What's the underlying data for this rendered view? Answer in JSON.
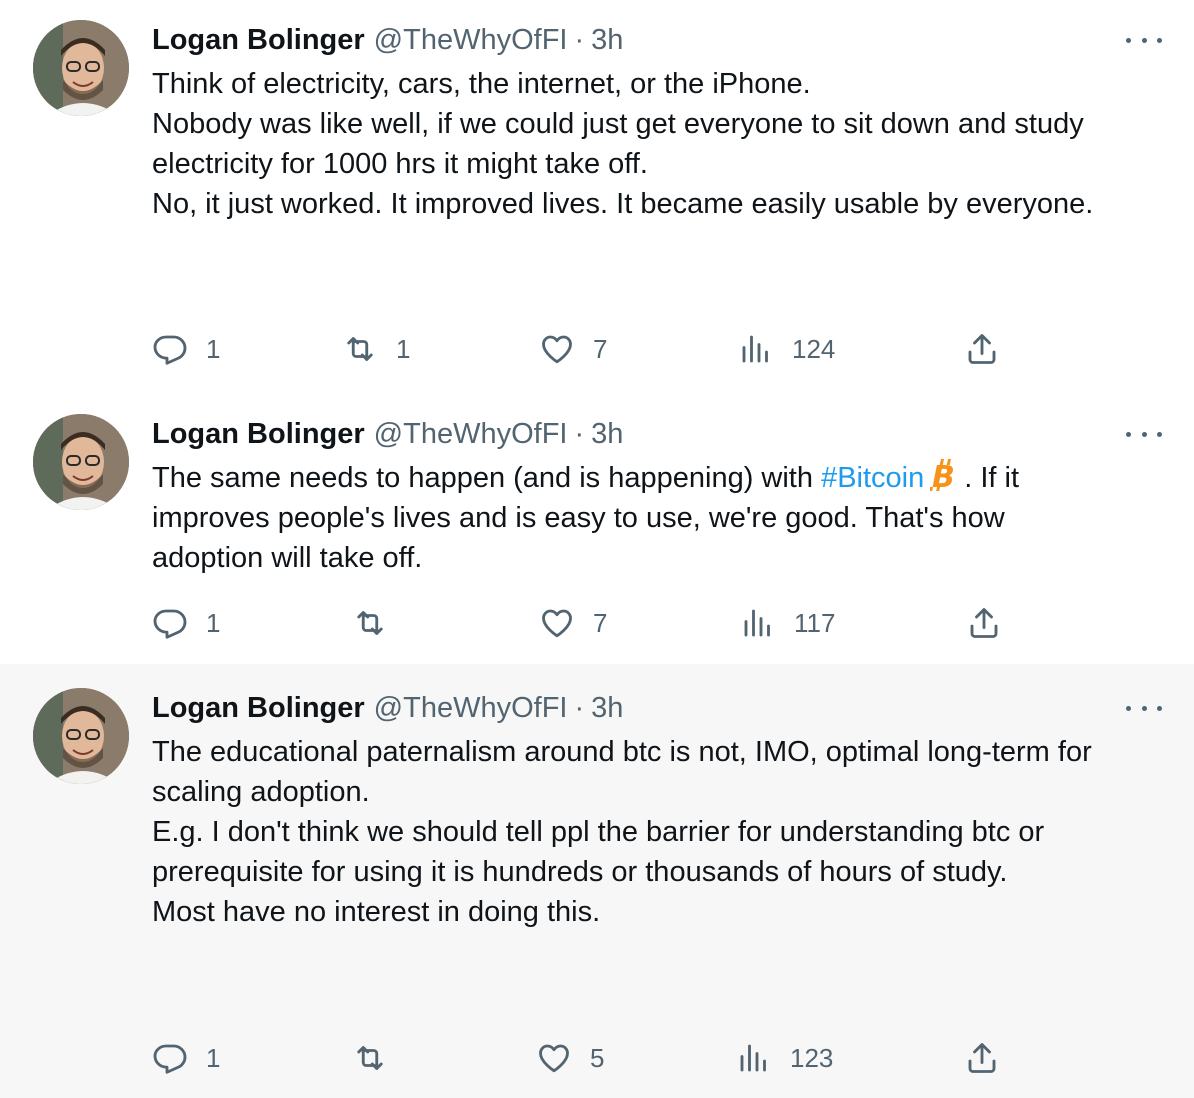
{
  "tweets": [
    {
      "name": "Logan Bolinger",
      "handle": "@TheWhyOfFI",
      "separator": "·",
      "time": "3h",
      "paragraphs": [
        [
          "Think of electricity, cars, the internet, or the iPhone."
        ],
        [
          "Nobody was like well, if we could just get everyone to sit down and study",
          "electricity for 1000 hrs it might take off."
        ],
        [
          "No, it just worked. It improved lives. It became easily usable by everyone."
        ]
      ],
      "replies": "1",
      "retweets": "1",
      "likes": "7",
      "views": "124"
    },
    {
      "name": "Logan Bolinger",
      "handle": "@TheWhyOfFI",
      "separator": "·",
      "time": "3h",
      "line1_before": "The same needs to happen (and is happening) with ",
      "hashtag": "#Bitcoin",
      "line1_after": ". If it",
      "line2": "improves people's lives and is easy to use, we're good.  That's how",
      "line3": "adoption will take off.",
      "replies": "1",
      "retweets": "",
      "likes": "7",
      "views": "117"
    },
    {
      "name": "Logan Bolinger",
      "handle": "@TheWhyOfFI",
      "separator": "·",
      "time": "3h",
      "paragraphs": [
        [
          "The educational paternalism around btc is not, IMO, optimal long-term for",
          "scaling adoption."
        ],
        [
          "E.g. I don't think we should tell ppl the barrier for understanding btc or",
          "prerequisite for using it is hundreds or thousands of hours of study."
        ],
        [
          "Most have no interest in doing this."
        ]
      ],
      "replies": "1",
      "retweets": "",
      "likes": "5",
      "views": "123"
    }
  ],
  "colors": {
    "text": "#0f1419",
    "secondary": "#536471",
    "link": "#1d9bf0",
    "bitcoin": "#f7931a",
    "thread_line": "#cfd9de",
    "highlight_bg": "#f7f7f7"
  },
  "icons": [
    "reply-icon",
    "retweet-icon",
    "like-icon",
    "views-icon",
    "share-icon",
    "more-icon",
    "bitcoin-icon"
  ]
}
